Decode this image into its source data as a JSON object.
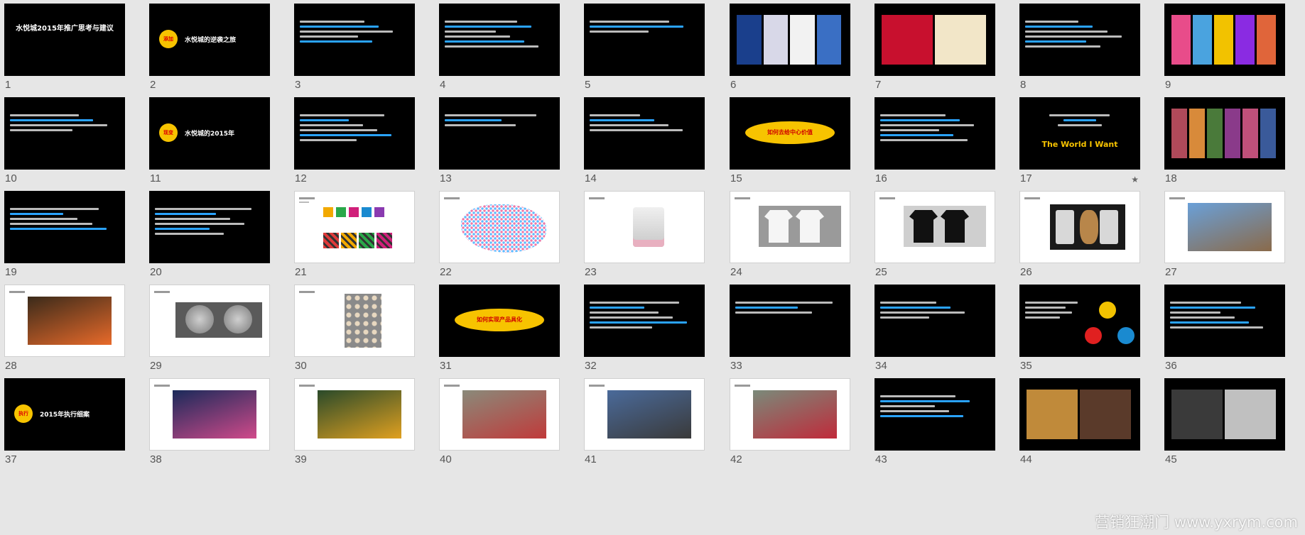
{
  "slides": [
    {
      "n": "1",
      "bg": "dark",
      "kind": "title",
      "text": "水悦城2015年推广思考与建议"
    },
    {
      "n": "2",
      "bg": "dark",
      "kind": "section",
      "badge": "添加",
      "text": "水悦城的逆袭之旅"
    },
    {
      "n": "3",
      "bg": "dark",
      "kind": "text"
    },
    {
      "n": "4",
      "bg": "dark",
      "kind": "text"
    },
    {
      "n": "5",
      "bg": "dark",
      "kind": "text"
    },
    {
      "n": "6",
      "bg": "dark",
      "kind": "photo",
      "colors": [
        "#1a3f8c",
        "#d8d8e8",
        "#f2f2f2",
        "#3a6fc4"
      ]
    },
    {
      "n": "7",
      "bg": "dark",
      "kind": "photo",
      "colors": [
        "#c8102e",
        "#f2e6c8"
      ]
    },
    {
      "n": "8",
      "bg": "dark",
      "kind": "text"
    },
    {
      "n": "9",
      "bg": "dark",
      "kind": "photo",
      "colors": [
        "#e84c8a",
        "#4aa3df",
        "#f2c200",
        "#8a2be2",
        "#e0653a"
      ]
    },
    {
      "n": "10",
      "bg": "dark",
      "kind": "text"
    },
    {
      "n": "11",
      "bg": "dark",
      "kind": "section",
      "badge": "现变",
      "text": "水悦城的2015年"
    },
    {
      "n": "12",
      "bg": "dark",
      "kind": "text"
    },
    {
      "n": "13",
      "bg": "dark",
      "kind": "text"
    },
    {
      "n": "14",
      "bg": "dark",
      "kind": "text"
    },
    {
      "n": "15",
      "bg": "dark",
      "kind": "oval",
      "text": "如何去给中心价值"
    },
    {
      "n": "16",
      "bg": "dark",
      "kind": "text"
    },
    {
      "n": "17",
      "bg": "dark",
      "kind": "tagline",
      "text": "The World I Want",
      "star": "★"
    },
    {
      "n": "18",
      "bg": "dark",
      "kind": "photo",
      "colors": [
        "#b04a5a",
        "#d88a3a",
        "#4a7a3a",
        "#8a3a8a",
        "#c0507a",
        "#3a5a9a"
      ]
    },
    {
      "n": "19",
      "bg": "dark",
      "kind": "text"
    },
    {
      "n": "20",
      "bg": "dark",
      "kind": "text"
    },
    {
      "n": "21",
      "bg": "light",
      "kind": "icons",
      "colors": [
        "#f2a900",
        "#2aa84a",
        "#d0207a",
        "#1a8ad0",
        "#8a3ab0"
      ]
    },
    {
      "n": "22",
      "bg": "light",
      "kind": "map"
    },
    {
      "n": "23",
      "bg": "light",
      "kind": "mug"
    },
    {
      "n": "24",
      "bg": "light",
      "kind": "tee",
      "color": "#f5f5f5",
      "bgc": "#9a9a9a"
    },
    {
      "n": "25",
      "bg": "light",
      "kind": "tee",
      "color": "#111",
      "bgc": "#cfcfcf"
    },
    {
      "n": "26",
      "bg": "light",
      "kind": "shirt"
    },
    {
      "n": "27",
      "bg": "light",
      "kind": "building",
      "colors": [
        "#6aa0d8",
        "#8a6a4a"
      ]
    },
    {
      "n": "28",
      "bg": "light",
      "kind": "building",
      "colors": [
        "#3a2a1a",
        "#e86a2a"
      ]
    },
    {
      "n": "29",
      "bg": "light",
      "kind": "coins"
    },
    {
      "n": "30",
      "bg": "light",
      "kind": "card"
    },
    {
      "n": "31",
      "bg": "dark",
      "kind": "oval",
      "text": "如何实现产品具化"
    },
    {
      "n": "32",
      "bg": "dark",
      "kind": "text"
    },
    {
      "n": "33",
      "bg": "dark",
      "kind": "text"
    },
    {
      "n": "34",
      "bg": "dark",
      "kind": "text"
    },
    {
      "n": "35",
      "bg": "dark",
      "kind": "diagram"
    },
    {
      "n": "36",
      "bg": "dark",
      "kind": "text"
    },
    {
      "n": "37",
      "bg": "dark",
      "kind": "section",
      "badge": "执行",
      "text": "2015年执行细案"
    },
    {
      "n": "38",
      "bg": "light",
      "kind": "building",
      "colors": [
        "#1a2a5a",
        "#d04a8a"
      ]
    },
    {
      "n": "39",
      "bg": "light",
      "kind": "building",
      "colors": [
        "#2a4a2a",
        "#e0a020"
      ]
    },
    {
      "n": "40",
      "bg": "light",
      "kind": "building",
      "colors": [
        "#8a8a7a",
        "#c03a3a"
      ]
    },
    {
      "n": "41",
      "bg": "light",
      "kind": "building",
      "colors": [
        "#4a6a9a",
        "#3a3a3a"
      ]
    },
    {
      "n": "42",
      "bg": "light",
      "kind": "building",
      "colors": [
        "#7a8a7a",
        "#c02a3a"
      ]
    },
    {
      "n": "43",
      "bg": "dark",
      "kind": "text"
    },
    {
      "n": "44",
      "bg": "dark",
      "kind": "photo",
      "colors": [
        "#c08a3a",
        "#5a3a2a"
      ]
    },
    {
      "n": "45",
      "bg": "dark",
      "kind": "photo",
      "colors": [
        "#3a3a3a",
        "#c0c0c0"
      ]
    }
  ],
  "watermark": "营销狂潮门 www.yxrym.com"
}
